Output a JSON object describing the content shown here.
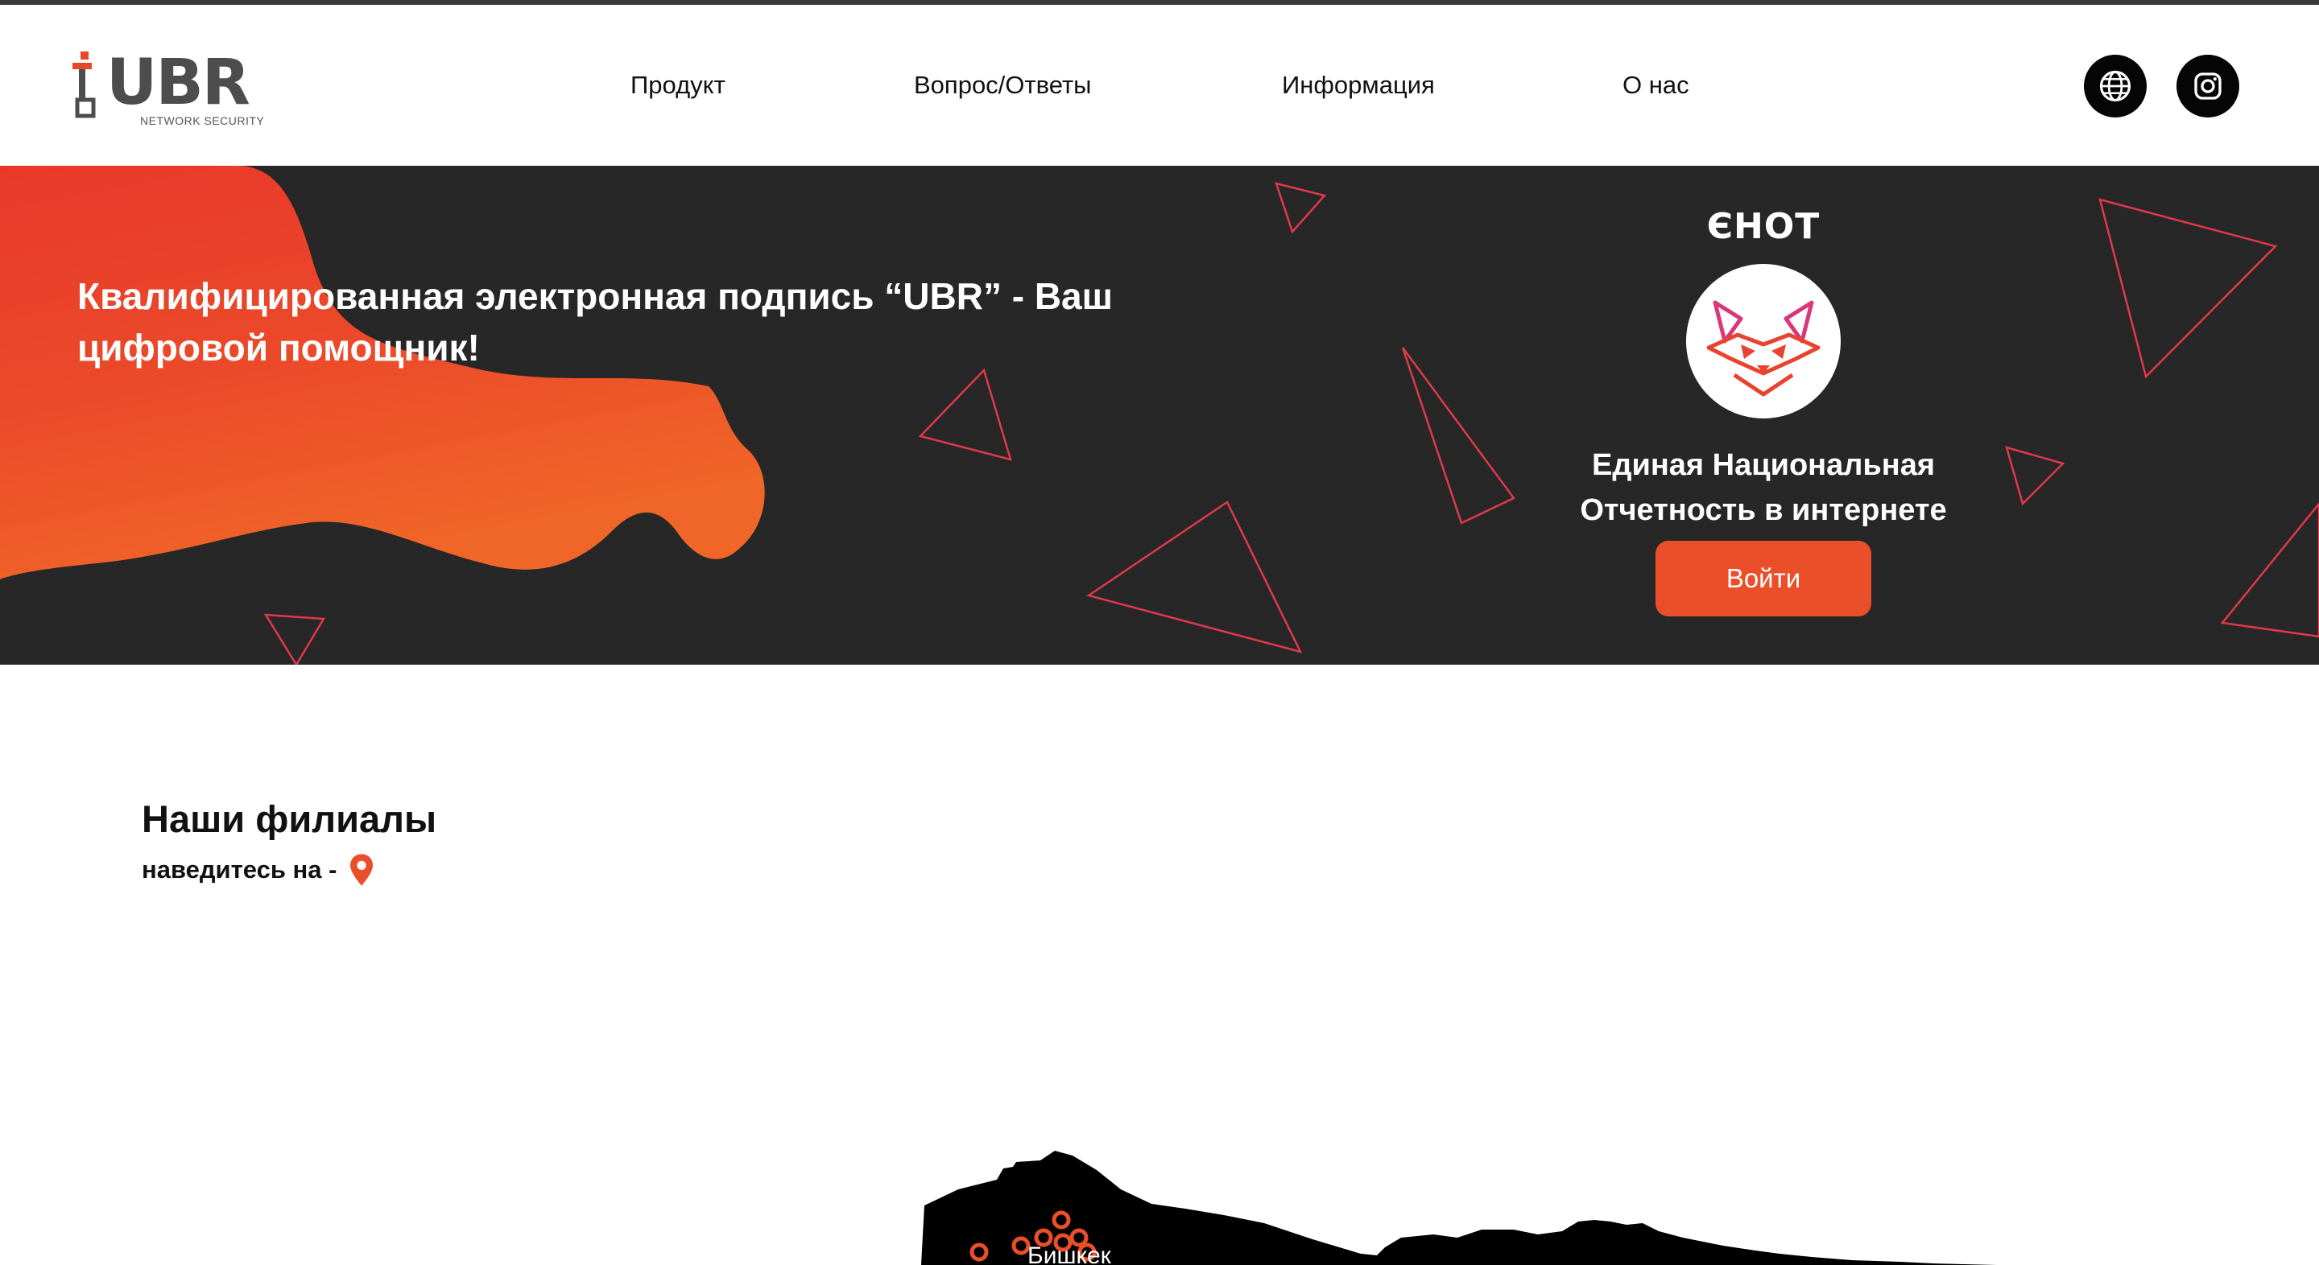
{
  "header": {
    "logo": {
      "name": "UBR",
      "subtitle": "NETWORK SECURITY"
    },
    "nav": [
      {
        "label": "Продукт"
      },
      {
        "label": "Вопрос/Ответы"
      },
      {
        "label": "Информация"
      },
      {
        "label": "О нас"
      }
    ],
    "icons": [
      "globe-icon",
      "instagram-icon"
    ]
  },
  "hero": {
    "title": "Квалифицированная электронная подпись “UBR” - Ваш цифровой помощник!",
    "partner": {
      "logo_text": "ЄHOT",
      "caption_line1": "Единая Национальная",
      "caption_line2": "Отчетность в интернете",
      "button_label": "Войти"
    }
  },
  "branches": {
    "title": "Наши филиалы",
    "hint": "наведитесь на -",
    "hint_icon": "location-pin-icon",
    "map_label": "Бишкек"
  },
  "colors": {
    "accent": "#ea4f2a",
    "hero_bg": "#272727",
    "triangle_stroke": "#e0394a",
    "header_bg": "#ffffff",
    "icon_button_bg": "#050505"
  }
}
